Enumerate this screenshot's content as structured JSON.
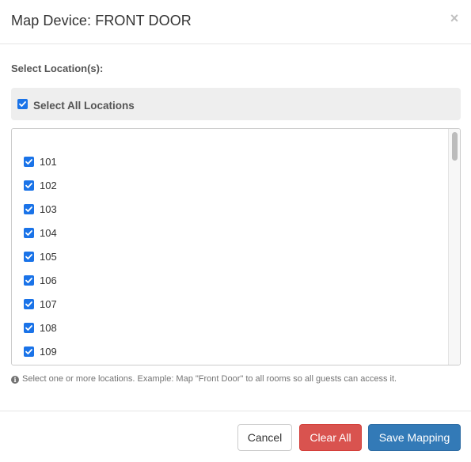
{
  "modal": {
    "title": "Map Device: FRONT DOOR",
    "close_glyph": "×"
  },
  "locations": {
    "section_label": "Select Location(s):",
    "select_all_label": "Select All Locations",
    "select_all_checked": true,
    "items": [
      {
        "label": "101",
        "checked": true
      },
      {
        "label": "102",
        "checked": true
      },
      {
        "label": "103",
        "checked": true
      },
      {
        "label": "104",
        "checked": true
      },
      {
        "label": "105",
        "checked": true
      },
      {
        "label": "106",
        "checked": true
      },
      {
        "label": "107",
        "checked": true
      },
      {
        "label": "108",
        "checked": true
      },
      {
        "label": "109",
        "checked": true
      }
    ]
  },
  "help": {
    "icon": "info-circle-icon",
    "text": "Select one or more locations. Example: Map \"Front Door\" to all rooms so all guests can access it."
  },
  "footer": {
    "cancel_label": "Cancel",
    "clear_label": "Clear All",
    "save_label": "Save Mapping"
  },
  "colors": {
    "checkbox": "#1a73e8",
    "clear_button": "#d9534f",
    "save_button": "#337ab7"
  }
}
